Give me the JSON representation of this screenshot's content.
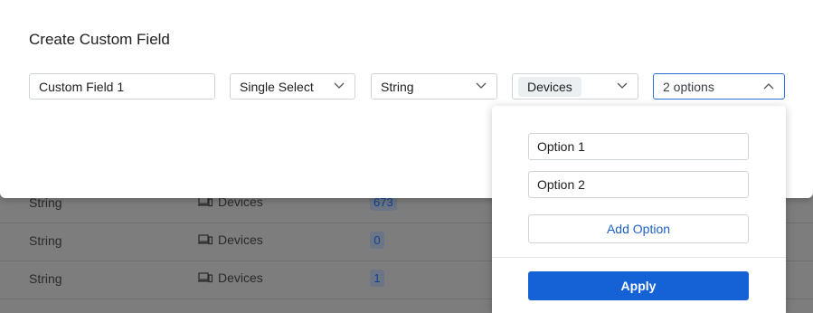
{
  "modal": {
    "title": "Create Custom Field",
    "name_value": "Custom Field 1",
    "kind_value": "Single Select",
    "data_type_value": "String",
    "applies_to_chip": "Devices",
    "options_summary": "2 options"
  },
  "options_panel": {
    "options": [
      "Option 1",
      "Option 2"
    ],
    "add_label": "Add Option",
    "apply_label": "Apply"
  },
  "background_table": {
    "rows": [
      {
        "type": "String",
        "applies_to": "Devices",
        "count": "673"
      },
      {
        "type": "String",
        "applies_to": "Devices",
        "count": "0"
      },
      {
        "type": "String",
        "applies_to": "Devices",
        "count": "1"
      }
    ]
  },
  "colors": {
    "accent": "#1562d6",
    "link": "#1f62c9",
    "overlay": "#7d7d7d"
  }
}
